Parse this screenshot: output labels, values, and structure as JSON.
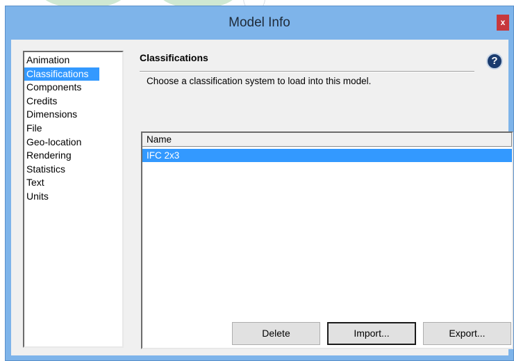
{
  "window": {
    "title": "Model Info",
    "close_label": "x"
  },
  "nav": {
    "items": [
      {
        "label": "Animation",
        "selected": false
      },
      {
        "label": "Classifications",
        "selected": true
      },
      {
        "label": "Components",
        "selected": false
      },
      {
        "label": "Credits",
        "selected": false
      },
      {
        "label": "Dimensions",
        "selected": false
      },
      {
        "label": "File",
        "selected": false
      },
      {
        "label": "Geo-location",
        "selected": false
      },
      {
        "label": "Rendering",
        "selected": false
      },
      {
        "label": "Statistics",
        "selected": false
      },
      {
        "label": "Text",
        "selected": false
      },
      {
        "label": "Units",
        "selected": false
      }
    ]
  },
  "panel": {
    "title": "Classifications",
    "help_icon": "question-mark",
    "description": "Choose a classification system to load into this model.",
    "table": {
      "columns": [
        "Name"
      ],
      "rows": [
        {
          "name": "IFC 2x3",
          "selected": true
        }
      ]
    },
    "buttons": {
      "delete": "Delete",
      "import": "Import...",
      "export": "Export..."
    }
  },
  "colors": {
    "selection": "#3399ff",
    "titlebar": "#7eb4ea",
    "close": "#c7383c"
  }
}
